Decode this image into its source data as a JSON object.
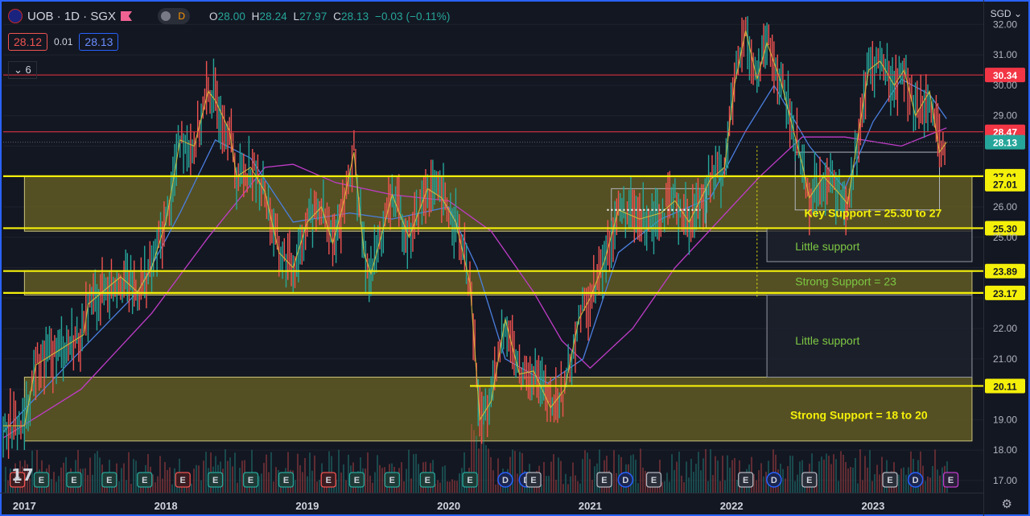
{
  "header": {
    "symbol": "UOB · 1D · SGX",
    "mode": "D",
    "open_label": "O",
    "open": "28.00",
    "high_label": "H",
    "high": "28.24",
    "low_label": "L",
    "low": "27.97",
    "close_label": "C",
    "close": "28.13",
    "change": "−0.03 (−0.11%)"
  },
  "quote": {
    "sell": "28.12",
    "spread": "0.01",
    "buy": "28.13"
  },
  "indicators_toggle": "6",
  "colors": {
    "background": "#131722",
    "up": "#26a69a",
    "down": "#ef5350",
    "zone": "#6b6424",
    "support_line": "#f5f00a",
    "resistance_line": "#f23645",
    "ma_blue": "#4a7fe0",
    "ma_purple": "#c03cc8",
    "ma_yellow": "#d9c13a",
    "note_text": "#7ec843",
    "frame": "#2962ff"
  },
  "chart_data": {
    "type": "line",
    "currency": "SGD",
    "ylim": [
      16.6,
      32.7
    ],
    "x_ticks": [
      "2017",
      "2018",
      "2019",
      "2020",
      "2021",
      "2022",
      "2023"
    ],
    "y_ticks": [
      "32.00",
      "31.00",
      "30.00",
      "29.00",
      "28.00",
      "27.00",
      "26.00",
      "25.00",
      "24.00",
      "23.00",
      "22.00",
      "21.00",
      "20.00",
      "19.00",
      "18.00",
      "17.00"
    ],
    "price_series": [
      {
        "x": 2016.85,
        "y": 18.8
      },
      {
        "x": 2017.0,
        "y": 18.8
      },
      {
        "x": 2017.08,
        "y": 20.8
      },
      {
        "x": 2017.25,
        "y": 21.3
      },
      {
        "x": 2017.42,
        "y": 21.8
      },
      {
        "x": 2017.45,
        "y": 22.8
      },
      {
        "x": 2017.55,
        "y": 23.2
      },
      {
        "x": 2017.68,
        "y": 23.7
      },
      {
        "x": 2017.8,
        "y": 23.2
      },
      {
        "x": 2017.9,
        "y": 24.0
      },
      {
        "x": 2018.0,
        "y": 25.5
      },
      {
        "x": 2018.05,
        "y": 26.8
      },
      {
        "x": 2018.1,
        "y": 28.2
      },
      {
        "x": 2018.2,
        "y": 28.0
      },
      {
        "x": 2018.3,
        "y": 29.8
      },
      {
        "x": 2018.35,
        "y": 29.5
      },
      {
        "x": 2018.45,
        "y": 28.5
      },
      {
        "x": 2018.5,
        "y": 27.0
      },
      {
        "x": 2018.6,
        "y": 27.3
      },
      {
        "x": 2018.7,
        "y": 26.5
      },
      {
        "x": 2018.8,
        "y": 24.5
      },
      {
        "x": 2018.9,
        "y": 24.0
      },
      {
        "x": 2019.0,
        "y": 25.5
      },
      {
        "x": 2019.1,
        "y": 26.0
      },
      {
        "x": 2019.18,
        "y": 24.8
      },
      {
        "x": 2019.25,
        "y": 26.0
      },
      {
        "x": 2019.33,
        "y": 27.8
      },
      {
        "x": 2019.4,
        "y": 24.5
      },
      {
        "x": 2019.45,
        "y": 23.8
      },
      {
        "x": 2019.55,
        "y": 25.5
      },
      {
        "x": 2019.6,
        "y": 26.4
      },
      {
        "x": 2019.72,
        "y": 25.0
      },
      {
        "x": 2019.85,
        "y": 26.6
      },
      {
        "x": 2019.95,
        "y": 26.3
      },
      {
        "x": 2020.05,
        "y": 25.5
      },
      {
        "x": 2020.15,
        "y": 23.5
      },
      {
        "x": 2020.22,
        "y": 19.0
      },
      {
        "x": 2020.3,
        "y": 19.6
      },
      {
        "x": 2020.4,
        "y": 22.3
      },
      {
        "x": 2020.5,
        "y": 20.5
      },
      {
        "x": 2020.6,
        "y": 20.6
      },
      {
        "x": 2020.72,
        "y": 19.4
      },
      {
        "x": 2020.82,
        "y": 20.0
      },
      {
        "x": 2020.92,
        "y": 22.3
      },
      {
        "x": 2021.0,
        "y": 23.0
      },
      {
        "x": 2021.1,
        "y": 24.2
      },
      {
        "x": 2021.2,
        "y": 25.9
      },
      {
        "x": 2021.35,
        "y": 25.6
      },
      {
        "x": 2021.5,
        "y": 25.8
      },
      {
        "x": 2021.6,
        "y": 26.2
      },
      {
        "x": 2021.7,
        "y": 25.5
      },
      {
        "x": 2021.85,
        "y": 26.9
      },
      {
        "x": 2021.95,
        "y": 27.3
      },
      {
        "x": 2022.02,
        "y": 30.0
      },
      {
        "x": 2022.1,
        "y": 31.8
      },
      {
        "x": 2022.18,
        "y": 30.2
      },
      {
        "x": 2022.25,
        "y": 31.4
      },
      {
        "x": 2022.35,
        "y": 30.1
      },
      {
        "x": 2022.45,
        "y": 28.3
      },
      {
        "x": 2022.5,
        "y": 27.4
      },
      {
        "x": 2022.55,
        "y": 26.3
      },
      {
        "x": 2022.65,
        "y": 27.0
      },
      {
        "x": 2022.75,
        "y": 26.5
      },
      {
        "x": 2022.82,
        "y": 26.1
      },
      {
        "x": 2022.9,
        "y": 28.5
      },
      {
        "x": 2022.97,
        "y": 30.5
      },
      {
        "x": 2023.05,
        "y": 30.8
      },
      {
        "x": 2023.15,
        "y": 30.0
      },
      {
        "x": 2023.22,
        "y": 30.5
      },
      {
        "x": 2023.3,
        "y": 29.0
      },
      {
        "x": 2023.4,
        "y": 29.8
      },
      {
        "x": 2023.47,
        "y": 27.8
      },
      {
        "x": 2023.52,
        "y": 28.13
      }
    ],
    "ma_long": [
      {
        "x": 2016.85,
        "y": 18.4
      },
      {
        "x": 2017.4,
        "y": 20.0
      },
      {
        "x": 2017.9,
        "y": 22.5
      },
      {
        "x": 2018.3,
        "y": 25.0
      },
      {
        "x": 2018.7,
        "y": 27.3
      },
      {
        "x": 2018.9,
        "y": 27.4
      },
      {
        "x": 2019.2,
        "y": 26.8
      },
      {
        "x": 2019.6,
        "y": 26.4
      },
      {
        "x": 2020.0,
        "y": 26.2
      },
      {
        "x": 2020.3,
        "y": 25.2
      },
      {
        "x": 2020.6,
        "y": 23.2
      },
      {
        "x": 2020.8,
        "y": 21.6
      },
      {
        "x": 2021.0,
        "y": 20.7
      },
      {
        "x": 2021.3,
        "y": 22.0
      },
      {
        "x": 2021.6,
        "y": 24.0
      },
      {
        "x": 2021.9,
        "y": 25.5
      },
      {
        "x": 2022.2,
        "y": 27.0
      },
      {
        "x": 2022.5,
        "y": 28.3
      },
      {
        "x": 2022.8,
        "y": 28.3
      },
      {
        "x": 2023.2,
        "y": 28.0
      },
      {
        "x": 2023.52,
        "y": 28.6
      }
    ],
    "ma_mid": [
      {
        "x": 2016.85,
        "y": 18.6
      },
      {
        "x": 2017.3,
        "y": 20.8
      },
      {
        "x": 2017.8,
        "y": 23.2
      },
      {
        "x": 2018.1,
        "y": 25.8
      },
      {
        "x": 2018.35,
        "y": 28.2
      },
      {
        "x": 2018.6,
        "y": 27.6
      },
      {
        "x": 2018.9,
        "y": 25.5
      },
      {
        "x": 2019.3,
        "y": 25.8
      },
      {
        "x": 2019.6,
        "y": 25.6
      },
      {
        "x": 2020.0,
        "y": 26.0
      },
      {
        "x": 2020.2,
        "y": 24.0
      },
      {
        "x": 2020.4,
        "y": 21.0
      },
      {
        "x": 2020.7,
        "y": 20.2
      },
      {
        "x": 2020.95,
        "y": 21.0
      },
      {
        "x": 2021.2,
        "y": 24.5
      },
      {
        "x": 2021.5,
        "y": 25.6
      },
      {
        "x": 2021.85,
        "y": 26.3
      },
      {
        "x": 2022.1,
        "y": 28.5
      },
      {
        "x": 2022.3,
        "y": 30.0
      },
      {
        "x": 2022.55,
        "y": 28.0
      },
      {
        "x": 2022.8,
        "y": 26.6
      },
      {
        "x": 2023.0,
        "y": 28.8
      },
      {
        "x": 2023.2,
        "y": 30.2
      },
      {
        "x": 2023.4,
        "y": 29.7
      },
      {
        "x": 2023.52,
        "y": 28.9
      }
    ],
    "levels": [
      {
        "value": 30.34,
        "label": "30.34",
        "kind": "resistance"
      },
      {
        "value": 28.47,
        "label": "28.47",
        "kind": "resistance"
      },
      {
        "value": 28.13,
        "label": "28.13",
        "kind": "last"
      },
      {
        "value": 27.01,
        "label": "27.01",
        "kind": "support"
      },
      {
        "value": 26.75,
        "label": "27.01",
        "kind": "support_tag"
      },
      {
        "value": 25.3,
        "label": "25.30",
        "kind": "support"
      },
      {
        "value": 23.89,
        "label": "23.89",
        "kind": "support"
      },
      {
        "value": 23.17,
        "label": "23.17",
        "kind": "support"
      },
      {
        "value": 20.11,
        "label": "20.11",
        "kind": "support"
      }
    ],
    "zones": [
      {
        "x0": 2017.0,
        "x1": 2023.7,
        "y0": 25.2,
        "y1": 27.0
      },
      {
        "x0": 2017.0,
        "x1": 2023.7,
        "y0": 23.1,
        "y1": 23.9
      },
      {
        "x0": 2017.0,
        "x1": 2023.7,
        "y0": 18.3,
        "y1": 20.4
      }
    ],
    "annotations": [
      {
        "text": "Key Support = 25.30 to 27",
        "x": 2023.0,
        "y": 25.8,
        "color": "#f5f00a"
      },
      {
        "text": "Little support",
        "x": 2022.45,
        "y": 24.7,
        "color": "#7ec843"
      },
      {
        "text": "Strong Support = 23",
        "x": 2022.45,
        "y": 23.55,
        "color": "#7ec843"
      },
      {
        "text": "Little support",
        "x": 2022.45,
        "y": 21.6,
        "color": "#7ec843"
      },
      {
        "text": "Strong Support = 18 to 20",
        "x": 2022.9,
        "y": 19.15,
        "color": "#f5f00a"
      }
    ],
    "event_markers": [
      {
        "x": 2016.95,
        "label": "E",
        "kind": "earn_down"
      },
      {
        "x": 2017.12,
        "label": "E",
        "kind": "earn_up"
      },
      {
        "x": 2017.35,
        "label": "E",
        "kind": "earn_up"
      },
      {
        "x": 2017.6,
        "label": "E",
        "kind": "earn_up"
      },
      {
        "x": 2017.85,
        "label": "E",
        "kind": "earn_up"
      },
      {
        "x": 2018.12,
        "label": "E",
        "kind": "earn_down"
      },
      {
        "x": 2018.35,
        "label": "E",
        "kind": "earn_up"
      },
      {
        "x": 2018.6,
        "label": "E",
        "kind": "earn_up"
      },
      {
        "x": 2018.85,
        "label": "E",
        "kind": "earn_up"
      },
      {
        "x": 2019.15,
        "label": "E",
        "kind": "earn_down"
      },
      {
        "x": 2019.35,
        "label": "E",
        "kind": "earn_up"
      },
      {
        "x": 2019.6,
        "label": "E",
        "kind": "earn_up"
      },
      {
        "x": 2019.85,
        "label": "E",
        "kind": "earn_up"
      },
      {
        "x": 2020.15,
        "label": "E",
        "kind": "earn_up"
      },
      {
        "x": 2020.4,
        "label": "D",
        "kind": "dividend"
      },
      {
        "x": 2020.55,
        "label": "D",
        "kind": "dividend"
      },
      {
        "x": 2020.6,
        "label": "E",
        "kind": "earn_neutral"
      },
      {
        "x": 2021.1,
        "label": "E",
        "kind": "earn_neutral"
      },
      {
        "x": 2021.25,
        "label": "D",
        "kind": "dividend"
      },
      {
        "x": 2021.45,
        "label": "E",
        "kind": "earn_neutral"
      },
      {
        "x": 2022.1,
        "label": "E",
        "kind": "earn_neutral"
      },
      {
        "x": 2022.3,
        "label": "D",
        "kind": "dividend"
      },
      {
        "x": 2022.55,
        "label": "E",
        "kind": "earn_neutral"
      },
      {
        "x": 2023.12,
        "label": "E",
        "kind": "earn_neutral"
      },
      {
        "x": 2023.3,
        "label": "D",
        "kind": "dividend"
      },
      {
        "x": 2023.55,
        "label": "E",
        "kind": "earn_future"
      }
    ]
  }
}
